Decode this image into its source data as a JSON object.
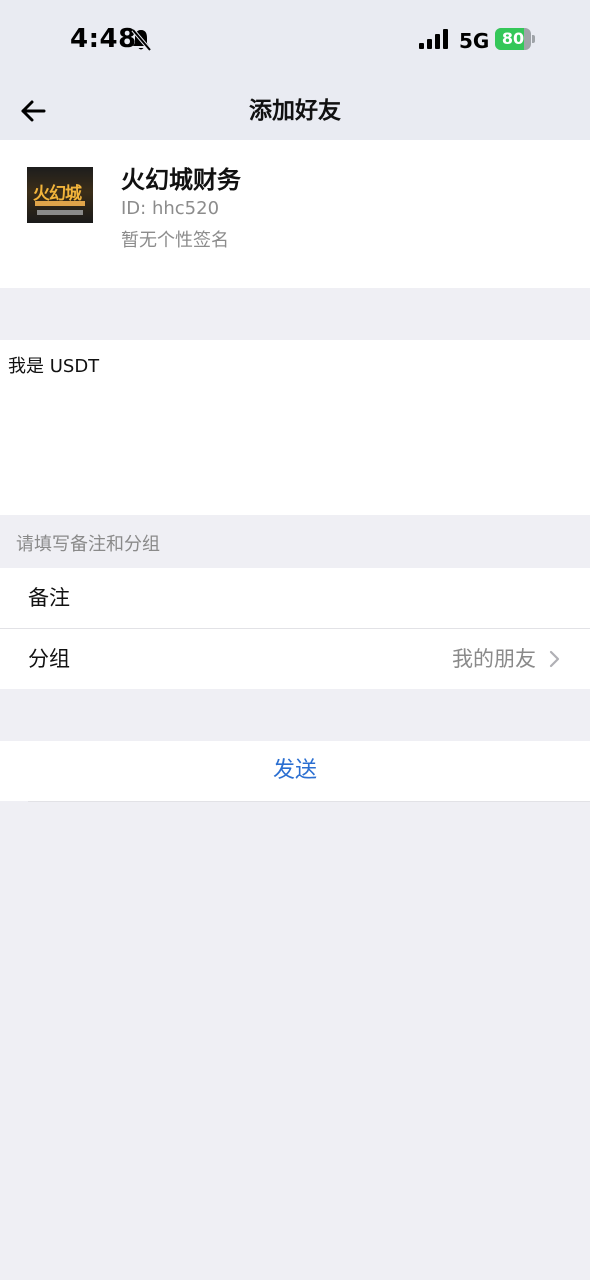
{
  "status_bar": {
    "time": "4:48",
    "network": "5G",
    "battery_level": "80",
    "battery_fraction": 0.8,
    "icons": [
      "bell-off-icon",
      "signal-icon",
      "battery-icon",
      "charging-icon"
    ],
    "colors": {
      "battery": "#34c759"
    }
  },
  "nav": {
    "title": "添加好友",
    "back_icon": "arrow-left-icon"
  },
  "profile": {
    "name": "火幻城财务",
    "id_text": "ID: hhc520",
    "signature": "暂无个性签名"
  },
  "message": {
    "text": "我是 USDT"
  },
  "form": {
    "section_label": "请填写备注和分组",
    "remark_label": "备注",
    "group_label": "分组",
    "group_value": "我的朋友"
  },
  "actions": {
    "send_label": "发送"
  },
  "colors": {
    "background": "#efeff4",
    "accent": "#2b6fd1",
    "secondary_text": "#8a8a8a"
  }
}
